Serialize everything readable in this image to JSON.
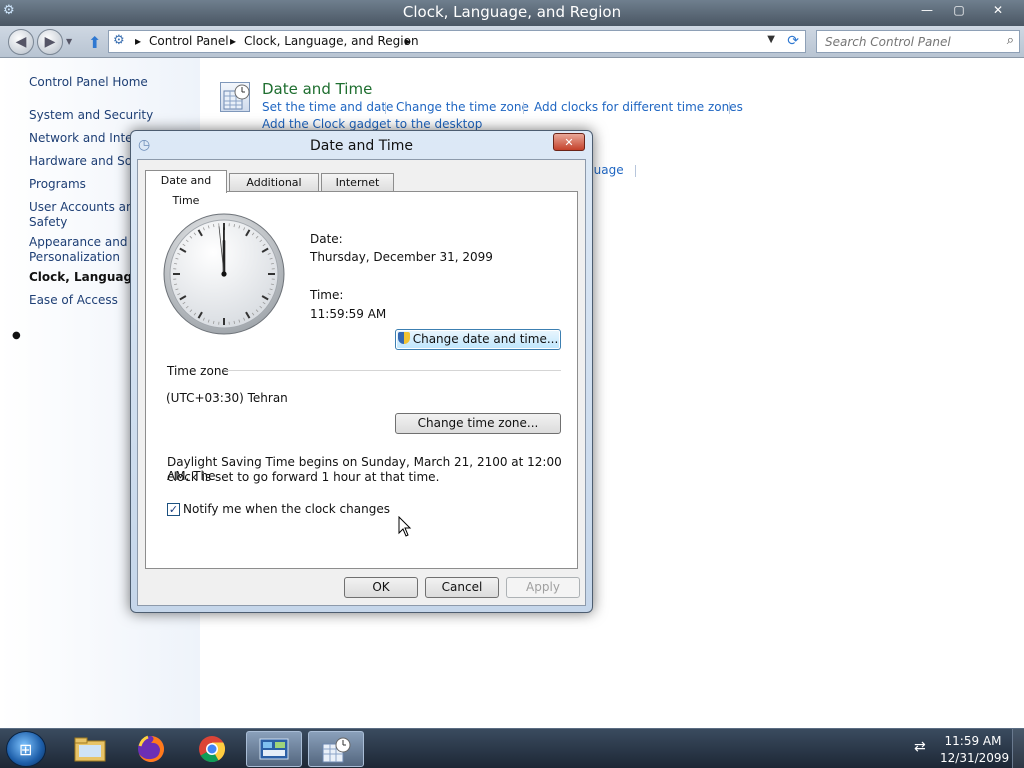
{
  "window": {
    "title": "Clock, Language, and Region",
    "controls": {
      "minimize": "—",
      "maximize": "▢",
      "close": "✕"
    }
  },
  "address_bar": {
    "crumbs": [
      "Control Panel",
      "Clock, Language, and Region"
    ],
    "separator": "▸",
    "search_placeholder": "Search Control Panel"
  },
  "left_pane": {
    "items": [
      "Control Panel Home",
      "System and Security",
      "Network and Intern",
      "Hardware and Soun",
      "Programs",
      "User Accounts and",
      "Safety",
      "Appearance and",
      "Personalization",
      "Clock, Language, a",
      "Ease of Access"
    ],
    "current_index": 9
  },
  "main": {
    "category": {
      "title": "Date and Time",
      "links": [
        "Set the time and date",
        "Change the time zone",
        "Add clocks for different time zones",
        "Add the Clock gadget to the desktop"
      ]
    },
    "partial_link": "guage"
  },
  "dialog": {
    "title": "Date and Time",
    "tabs": [
      "Date and Time",
      "Additional Clocks",
      "Internet Time"
    ],
    "selected_tab": 0,
    "date_label": "Date:",
    "date_value": "Thursday, December 31, 2099",
    "time_label": "Time:",
    "time_value": "11:59:59 AM",
    "change_datetime_button": "Change date and time...",
    "timezone_heading": "Time zone",
    "timezone_value": "(UTC+03:30) Tehran",
    "change_timezone_button": "Change time zone...",
    "dst_line1": "Daylight Saving Time begins on Sunday, March 21, 2100 at 12:00 AM. The",
    "dst_line2": "clock is set to go forward 1 hour at that time.",
    "notify_label": "Notify me when the clock changes",
    "notify_checked": true,
    "ok_button": "OK",
    "cancel_button": "Cancel",
    "apply_button": "Apply",
    "analog_clock": {
      "hours": 11,
      "minutes": 59,
      "seconds": 59
    }
  },
  "taskbar": {
    "clock_time": "11:59 AM",
    "clock_date": "12/31/2099",
    "apps": [
      "windows-explorer-icon",
      "firefox-icon",
      "chrome-icon",
      "control-panel-icon",
      "date-time-icon"
    ]
  }
}
